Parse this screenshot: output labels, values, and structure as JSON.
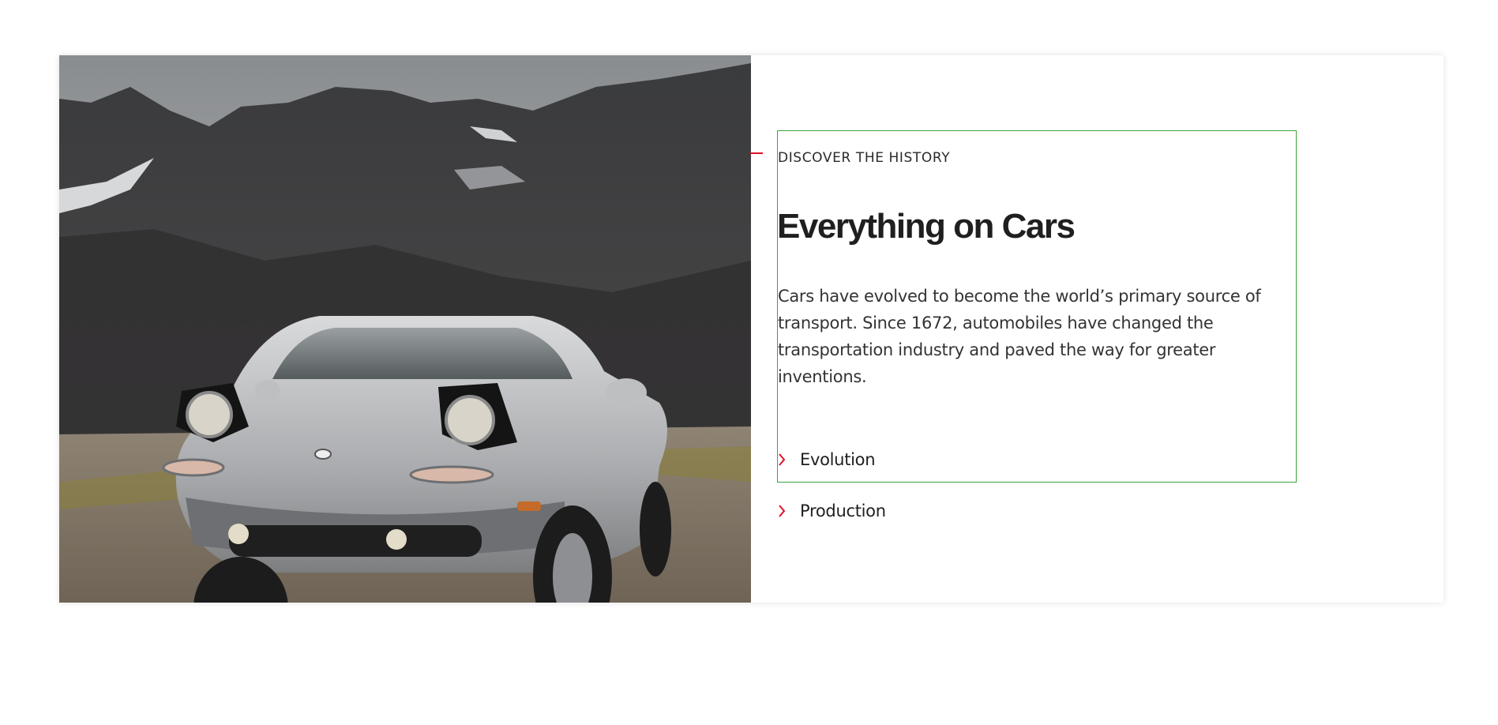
{
  "section": {
    "eyebrow": "DISCOVER THE HISTORY",
    "title": "Everything on Cars",
    "description": "Cars have evolved to become the world’s primary source of transport. Since 1672, automobiles have changed the transportation industry and paved the way for greater inventions.",
    "links": [
      {
        "label": "Evolution",
        "icon": "chevron-right-icon"
      },
      {
        "label": "Production",
        "icon": "chevron-right-icon"
      }
    ]
  },
  "colors": {
    "accent": "#e0102a",
    "outline": "#3aa63a",
    "heading": "#1f1f1f",
    "text": "#333333"
  }
}
